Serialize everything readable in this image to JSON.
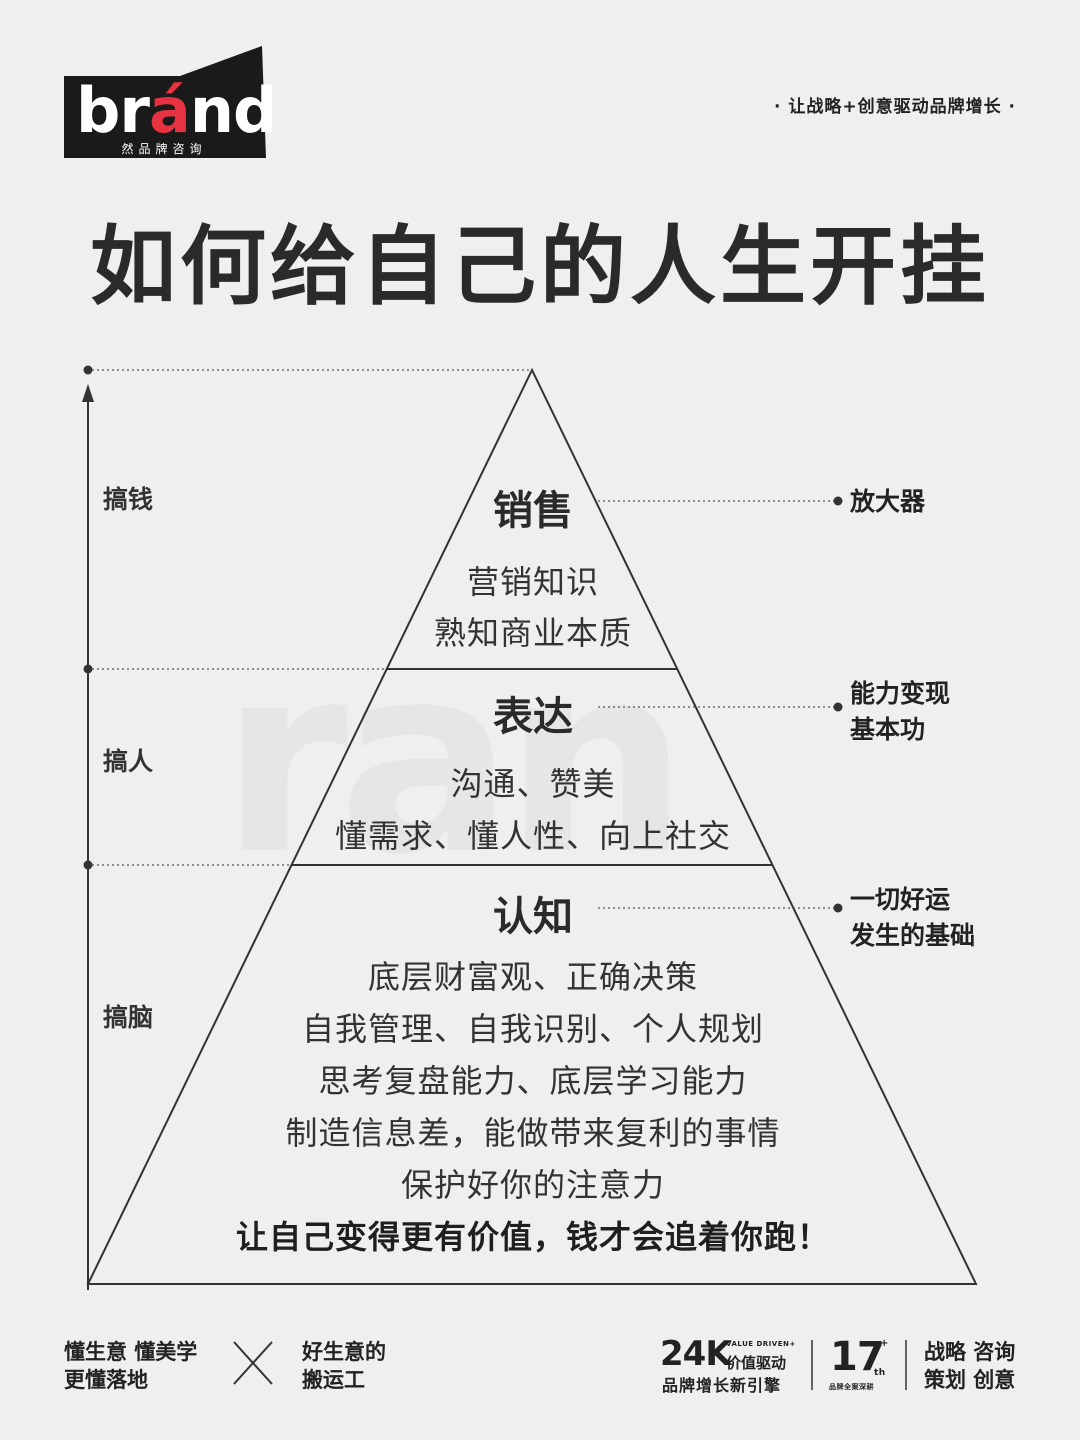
{
  "logo": {
    "word_pre": "br",
    "word_accent": "á",
    "word_post": "nd",
    "subtitle": "然品牌咨询"
  },
  "slogan": "· 让战略+创意驱动品牌增长 ·",
  "title": "如何给自己的人生开挂",
  "left_labels": [
    "搞钱",
    "搞人",
    "搞脑"
  ],
  "layers": [
    {
      "title": "销售",
      "lines": [
        "营销知识",
        "熟知商业本质"
      ],
      "right_label": [
        "放大器"
      ]
    },
    {
      "title": "表达",
      "lines": [
        "沟通、赞美",
        "懂需求、懂人性、向上社交"
      ],
      "right_label": [
        "能力变现",
        "基本功"
      ]
    },
    {
      "title": "认知",
      "lines": [
        "底层财富观、正确决策",
        "自我管理、自我识别、个人规划",
        "思考复盘能力、底层学习能力",
        "制造信息差，能做带来复利的事情",
        "保护好你的注意力"
      ],
      "emphasis": "让自己变得更有价值，钱才会追着你跑！",
      "right_label": [
        "一切好运",
        "发生的基础"
      ]
    }
  ],
  "watermark": "ran",
  "footer": {
    "left_lines": [
      "懂生意 懂美学",
      "更懂落地"
    ],
    "cross": "✕",
    "mid_lines": [
      "好生意的",
      "搬运工"
    ],
    "value_num": "24K",
    "value_en": "VALUE DRIVEN",
    "value_plus": "+",
    "value_cn": "价值驱动",
    "value_sub": "品牌增长新引擎",
    "years_num": "17",
    "years_plus": "+",
    "years_th": "th",
    "years_sub": "品牌全案深耕",
    "services": [
      "战略 咨询",
      "策划 创意"
    ]
  },
  "colors": {
    "background": "#efefef",
    "logo_bg": "#1a1a1a",
    "accent": "#e63241",
    "text": "#222222"
  }
}
